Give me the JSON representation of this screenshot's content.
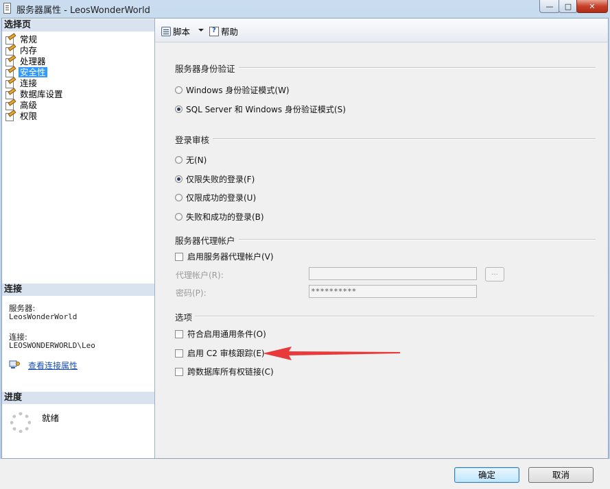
{
  "window": {
    "title": "服务器属性 - LeosWonderWorld",
    "minimize_icon": "—",
    "maximize_icon": "□",
    "close_icon": "✕"
  },
  "left_panel": {
    "select_page_header": "选择页",
    "nav_items": [
      {
        "label": "常规",
        "selected": false
      },
      {
        "label": "内存",
        "selected": false
      },
      {
        "label": "处理器",
        "selected": false
      },
      {
        "label": "安全性",
        "selected": true
      },
      {
        "label": "连接",
        "selected": false
      },
      {
        "label": "数据库设置",
        "selected": false
      },
      {
        "label": "高级",
        "selected": false
      },
      {
        "label": "权限",
        "selected": false
      }
    ],
    "connection": {
      "header": "连接",
      "server_label": "服务器:",
      "server_value": "LeosWonderWorld",
      "connection_label": "连接:",
      "connection_value": "LEOSWONDERWORLD\\Leo",
      "view_properties_link": "查看连接属性"
    },
    "progress": {
      "header": "进度",
      "status": "就绪"
    }
  },
  "toolbar": {
    "script_label": "脚本",
    "help_label": "帮助"
  },
  "security": {
    "server_auth": {
      "title": "服务器身份验证",
      "options": [
        {
          "label": "Windows 身份验证模式(W)",
          "selected": false
        },
        {
          "label": "SQL Server 和 Windows 身份验证模式(S)",
          "selected": true
        }
      ]
    },
    "login_audit": {
      "title": "登录审核",
      "options": [
        {
          "label": "无(N)",
          "selected": false
        },
        {
          "label": "仅限失败的登录(F)",
          "selected": true
        },
        {
          "label": "仅限成功的登录(U)",
          "selected": false
        },
        {
          "label": "失败和成功的登录(B)",
          "selected": false
        }
      ]
    },
    "proxy_account": {
      "title": "服务器代理帐户",
      "enable_label": "启用服务器代理帐户(V)",
      "enabled": false,
      "account_label": "代理帐户(R):",
      "account_value": "",
      "browse_label": "...",
      "password_label": "密码(P):",
      "password_value": "**********"
    },
    "options": {
      "title": "选项",
      "items": [
        {
          "label": "符合启用通用条件(O)",
          "checked": false
        },
        {
          "label": "启用 C2 审核跟踪(E)",
          "checked": false
        },
        {
          "label": "跨数据库所有权链接(C)",
          "checked": false
        }
      ]
    }
  },
  "footer": {
    "ok_label": "确定",
    "cancel_label": "取消"
  },
  "colors": {
    "annotation_arrow": "#e83a3a",
    "selection": "#3399ff"
  }
}
